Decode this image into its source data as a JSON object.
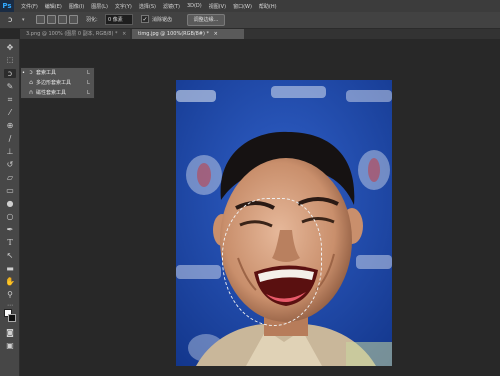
{
  "app": {
    "logo": "Ps"
  },
  "menubar": [
    "文件(F)",
    "编辑(E)",
    "图像(I)",
    "图层(L)",
    "文字(Y)",
    "选择(S)",
    "滤镜(T)",
    "3D(D)",
    "视图(V)",
    "窗口(W)",
    "帮助(H)"
  ],
  "options": {
    "feather_label": "羽化:",
    "feather_value": "0 像素",
    "antialias_label": "消除锯齿",
    "antialias_checked": "✓",
    "refine_edge": "调整边缘..."
  },
  "tabs": [
    {
      "label": "3.png @ 100% (图层 0 副本, RGB/8) *",
      "close": "×"
    },
    {
      "label": "timg.jpg @ 100%(RGB/8#) *",
      "close": "×"
    }
  ],
  "flyout": [
    {
      "label": "套索工具",
      "key": "L",
      "icon": "lasso-icon",
      "active": "•"
    },
    {
      "label": "多边形套索工具",
      "key": "L",
      "icon": "polygonal-lasso-icon",
      "active": ""
    },
    {
      "label": "磁性套索工具",
      "key": "L",
      "icon": "magnetic-lasso-icon",
      "active": ""
    }
  ],
  "colors": {
    "accent": "#31a8ff",
    "panel": "#474747",
    "workspace": "#282828"
  }
}
